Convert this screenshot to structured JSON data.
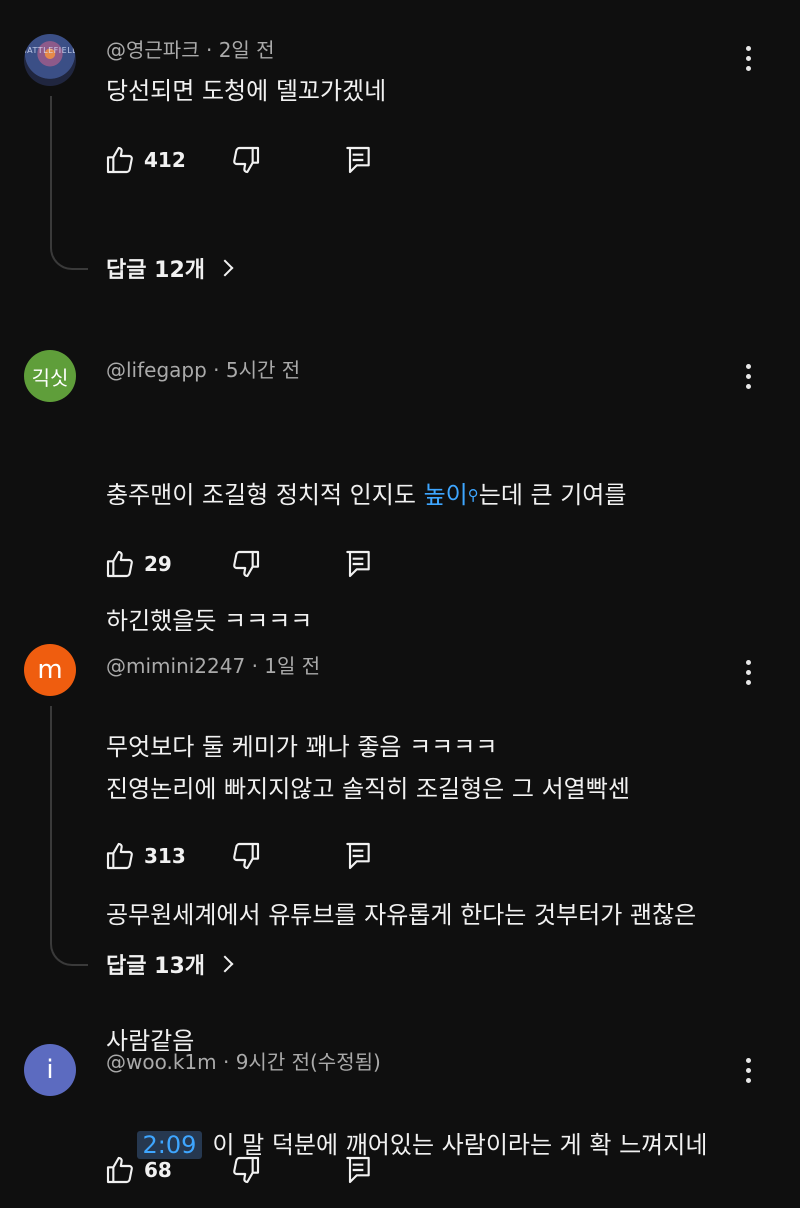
{
  "colors": {
    "background": "#0f0f0f",
    "text": "#f1f1f1",
    "meta": "#aaaaaa",
    "link": "#3ea6ff"
  },
  "comments": [
    {
      "avatar": {
        "type": "image",
        "watermark": "BATTLEFIELD"
      },
      "author": "@영근파크",
      "time": "2일 전",
      "lines": [
        "당선되면 도청에 델꼬가겠네"
      ],
      "likes": "412",
      "replies_label": "답글 12개"
    },
    {
      "avatar": {
        "type": "text",
        "text": "긱싯",
        "color": "#5f9e3a"
      },
      "author": "@lifegapp",
      "time": "5시간 전",
      "line1_before": "충주맨이 조길형 정치적 인지도 ",
      "line1_link": "높이",
      "line1_after": "는데 큰 기여를",
      "line2": "하긴했을듯 ㅋㅋㅋㅋ",
      "line3": "무엇보다 둘 케미가 꽤나 좋음 ㅋㅋㅋㅋ",
      "likes": "29"
    },
    {
      "avatar": {
        "type": "text",
        "text": "m",
        "color": "#ef5d0f"
      },
      "author": "@mimini2247",
      "time": "1일 전",
      "lines": [
        "진영논리에 빠지지않고 솔직히 조길형은 그 서열빡센",
        "공무원세계에서 유튜브를 자유롭게 한다는 것부터가 괜찮은",
        "사람같음"
      ],
      "likes": "313",
      "replies_label": "답글 13개"
    },
    {
      "avatar": {
        "type": "text",
        "text": "i",
        "color": "#5c6bc0"
      },
      "author": "@woo.k1m",
      "time": "9시간 전(수정됨)",
      "timestamp_link": "2:09",
      "text": "이 말 덕분에 깨어있는 사람이라는 게 확 느껴지네",
      "likes": "68"
    }
  ]
}
